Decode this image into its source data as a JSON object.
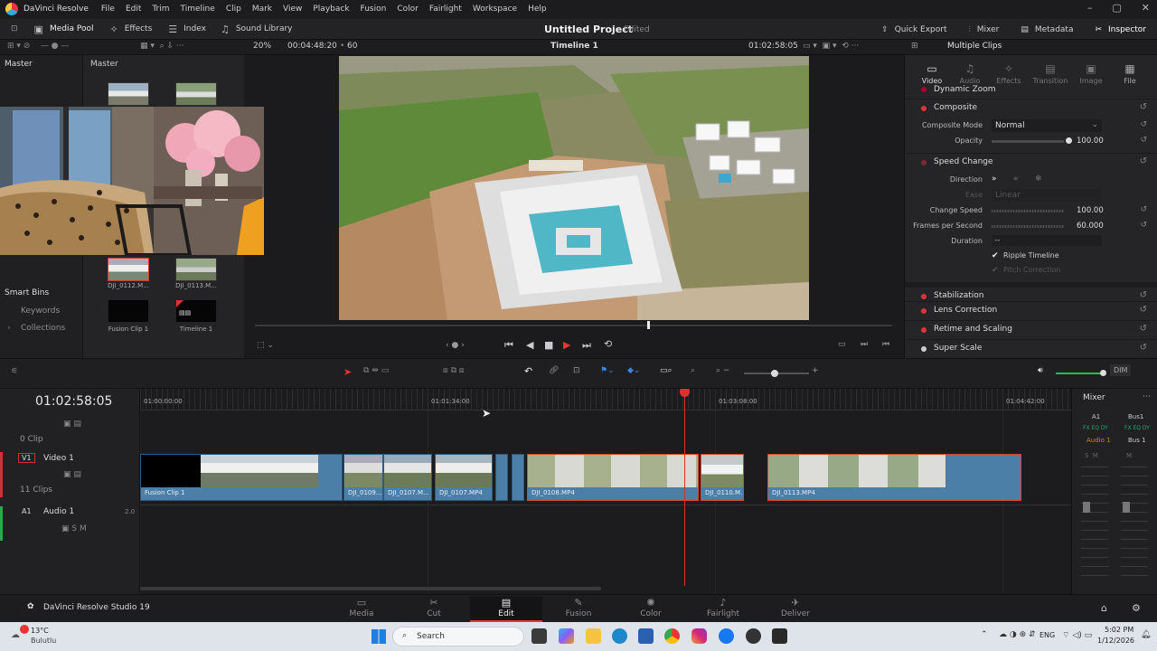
{
  "menubar": {
    "app_title": "DaVinci Resolve",
    "items": [
      "File",
      "Edit",
      "Trim",
      "Timeline",
      "Clip",
      "Mark",
      "View",
      "Playback",
      "Fusion",
      "Color",
      "Fairlight",
      "Workspace",
      "Help"
    ]
  },
  "toolbar": {
    "media_pool": "Media Pool",
    "effects": "Effects",
    "index": "Index",
    "sound_library": "Sound Library",
    "project_title": "Untitled Project",
    "project_status": "Edited",
    "quick_export": "Quick Export",
    "mixer": "Mixer",
    "metadata": "Metadata",
    "inspector": "Inspector"
  },
  "toolbar2": {
    "zoom": "20%",
    "timecode": "00:04:48:20",
    "fps": "60",
    "timeline_name": "Timeline 1",
    "timeline_tc": "01:02:58:05",
    "inspector_title": "Multiple Clips"
  },
  "bins": {
    "master": "Master",
    "smart_bins": "Smart Bins",
    "keywords": "Keywords",
    "collections": "Collections"
  },
  "media_pool": {
    "header": "Master",
    "items": [
      {
        "label": "DJI_0112.M..."
      },
      {
        "label": "DJI_0113.M..."
      },
      {
        "label": "Fusion Clip 1"
      },
      {
        "label": "Timeline 1"
      }
    ]
  },
  "inspector": {
    "tabs": [
      "Video",
      "Audio",
      "Effects",
      "Transition",
      "Image",
      "File"
    ],
    "dynamic_zoom": "Dynamic Zoom",
    "composite": "Composite",
    "composite_mode_label": "Composite Mode",
    "composite_mode_value": "Normal",
    "opacity_label": "Opacity",
    "opacity_value": "100.00",
    "speed_change": "Speed Change",
    "direction_label": "Direction",
    "ease_label": "Ease",
    "ease_value": "Linear",
    "change_speed_label": "Change Speed",
    "change_speed_value": "100.00",
    "fps_label": "Frames per Second",
    "fps_value": "60.000",
    "duration_label": "Duration",
    "duration_value": "--",
    "ripple_label": "Ripple Timeline",
    "pitch_label": "Pitch Correction",
    "stabilization": "Stabilization",
    "lens_correction": "Lens Correction",
    "retime_scaling": "Retime and Scaling",
    "super_scale": "Super Scale"
  },
  "timeline": {
    "current_tc": "01:02:58:05",
    "ruler": [
      "01:00:00:00",
      "01:01:34:00",
      "01:03:08:00",
      "01:04:42:00"
    ],
    "track_blank_count": "0 Clip",
    "v1_id": "V1",
    "v1_name": "Video 1",
    "v1_count": "11 Clips",
    "a1_id": "A1",
    "a1_name": "Audio 1",
    "a1_level": "2.0",
    "clips": [
      "Fusion Clip 1",
      "DJI_0109....",
      "DJI_0107.M...",
      "DJI_0107.MP4",
      "DJI_0108.MP4",
      "DJI_0110.M...",
      "DJI_0113.MP4"
    ]
  },
  "mixer": {
    "title": "Mixer",
    "a1": "A1",
    "bus1": "Bus1",
    "audio1": "Audio 1",
    "bus1b": "Bus 1",
    "dim": "DIM"
  },
  "pages": [
    "Media",
    "Cut",
    "Edit",
    "Fusion",
    "Color",
    "Fairlight",
    "Deliver"
  ],
  "brand": "DaVinci Resolve Studio 19",
  "taskbar": {
    "weather_temp": "13°C",
    "weather_desc": "Bulutlu",
    "search": "Search",
    "lang": "ENG",
    "time": "5:02 PM",
    "date": "1/12/2026"
  }
}
